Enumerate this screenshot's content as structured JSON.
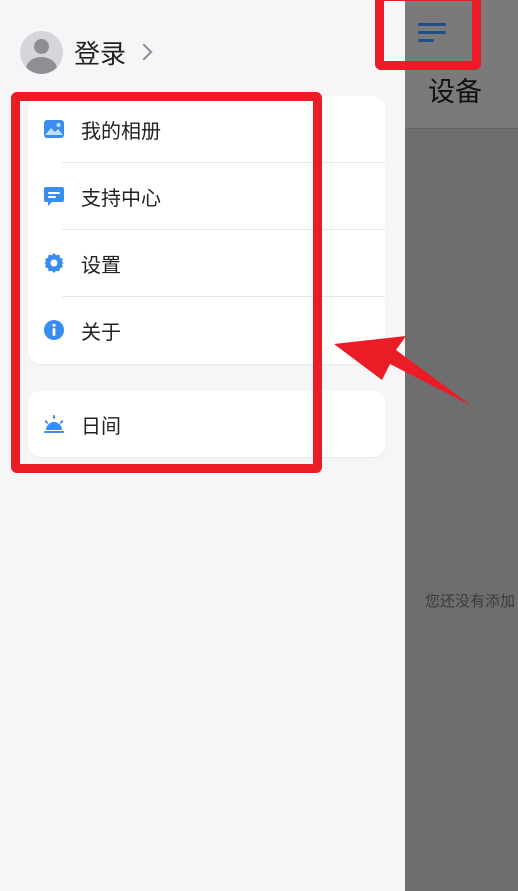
{
  "background": {
    "title": "设备",
    "empty_text": "您还没有添加",
    "menu_icon": "hamburger-icon"
  },
  "drawer": {
    "login_label": "登录",
    "menu": [
      {
        "label": "我的相册",
        "icon": "photo-album-icon"
      },
      {
        "label": "支持中心",
        "icon": "support-chat-icon"
      },
      {
        "label": "设置",
        "icon": "gear-icon"
      },
      {
        "label": "关于",
        "icon": "info-icon"
      }
    ],
    "theme": {
      "label": "日间",
      "icon": "sunrise-icon"
    }
  },
  "colors": {
    "accent": "#3a8df0",
    "annotation": "#ea1c26",
    "drawer_bg": "#f6f6f8"
  }
}
